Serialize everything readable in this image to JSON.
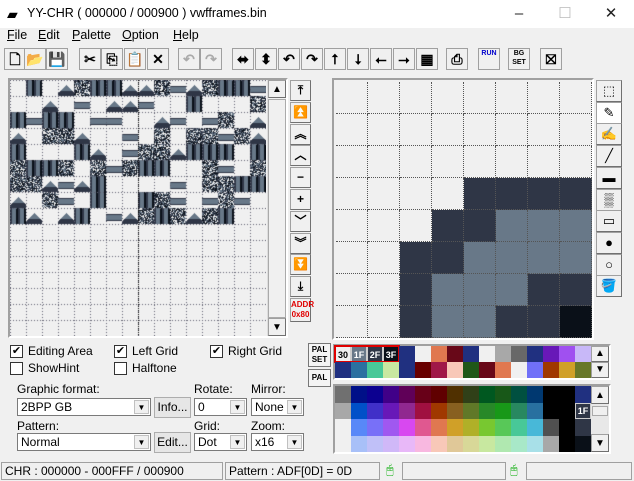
{
  "window": {
    "title": "YY-CHR ( 000000 / 000900 ) vwfframes.bin",
    "minimize": "–",
    "maximize": "☐",
    "close": "✕"
  },
  "menu": [
    {
      "label": "File",
      "key": "F",
      "rest": "ile"
    },
    {
      "label": "Edit",
      "key": "E",
      "rest": "dit"
    },
    {
      "label": "Palette",
      "key": "P",
      "rest": "alette"
    },
    {
      "label": "Option",
      "key": "O",
      "rest": "ption"
    },
    {
      "label": "Help",
      "key": "H",
      "rest": "elp"
    }
  ],
  "toolbar": [
    {
      "name": "new-icon",
      "g": "🗋",
      "dis": false
    },
    {
      "name": "open-icon",
      "g": "📂",
      "dis": false
    },
    {
      "name": "save-icon",
      "g": "💾",
      "dis": false
    },
    {
      "name": "cut-icon",
      "g": "✂",
      "dis": false
    },
    {
      "name": "copy-icon",
      "g": "⎘",
      "dis": false
    },
    {
      "name": "paste-icon",
      "g": "📋",
      "dis": false
    },
    {
      "name": "delete-icon",
      "g": "✕",
      "dis": false
    },
    {
      "name": "undo-icon",
      "g": "↶",
      "dis": true
    },
    {
      "name": "redo-icon",
      "g": "↷",
      "dis": true
    },
    {
      "name": "flip-horizontal-icon",
      "g": "⬌",
      "dis": false
    },
    {
      "name": "flip-vertical-icon",
      "g": "⬍",
      "dis": false
    },
    {
      "name": "rotate-left-icon",
      "g": "↶",
      "dis": false
    },
    {
      "name": "rotate-right-icon",
      "g": "↷",
      "dis": false
    },
    {
      "name": "shift-up-icon",
      "g": "⭡",
      "dis": false
    },
    {
      "name": "shift-down-icon",
      "g": "⭣",
      "dis": false
    },
    {
      "name": "shift-left-icon",
      "g": "⭠",
      "dis": false
    },
    {
      "name": "shift-right-icon",
      "g": "⭢",
      "dis": false
    },
    {
      "name": "replace-color-icon",
      "g": "▦",
      "dis": false
    },
    {
      "name": "capture-icon",
      "g": "⎙",
      "dis": false
    },
    {
      "name": "run-icon",
      "g": "RUN",
      "dis": false
    },
    {
      "name": "bg-set-icon",
      "g": "BG SET",
      "dis": false
    },
    {
      "name": "exit-icon",
      "g": "⛝",
      "dis": false
    }
  ],
  "scroll_buttons": [
    {
      "name": "scroll-top",
      "g": "⤒"
    },
    {
      "name": "scroll-page-up-fast",
      "g": "⏫"
    },
    {
      "name": "scroll-page-up",
      "g": "︽"
    },
    {
      "name": "scroll-up",
      "g": "︿"
    },
    {
      "name": "scroll-minus",
      "g": "−"
    },
    {
      "name": "scroll-plus",
      "g": "+"
    },
    {
      "name": "scroll-down",
      "g": "﹀"
    },
    {
      "name": "scroll-page-down",
      "g": "︾"
    },
    {
      "name": "scroll-page-down-fast",
      "g": "⏬"
    },
    {
      "name": "scroll-bottom",
      "g": "⤓"
    }
  ],
  "addr_button": {
    "line1": "ADDR",
    "line2": "0x80"
  },
  "tools": [
    {
      "name": "select-tool",
      "g": "⬚"
    },
    {
      "name": "pen-tool",
      "g": "✎"
    },
    {
      "name": "brush-tool",
      "g": "✍"
    },
    {
      "name": "line-tool",
      "g": "╱"
    },
    {
      "name": "filled-rect-tool",
      "g": "▬"
    },
    {
      "name": "pattern-fill-tool",
      "g": "▒"
    },
    {
      "name": "rect-tool",
      "g": "▭"
    },
    {
      "name": "filled-circle-tool",
      "g": "●"
    },
    {
      "name": "circle-tool",
      "g": "○"
    },
    {
      "name": "fill-tool",
      "g": "🪣"
    }
  ],
  "edit_pixels": [
    "00000000",
    "00000000",
    "00000000",
    "00002222",
    "00022111",
    "00221111",
    "00211122",
    "00211223"
  ],
  "tile_colors": [
    "#f0f0f0",
    "#687888",
    "#2f3646",
    "#0a1018"
  ],
  "checkboxes": {
    "editing_area": {
      "label": "Editing Area",
      "checked": true
    },
    "left_grid": {
      "label": "Left Grid",
      "checked": true
    },
    "right_grid": {
      "label": "Right Grid",
      "checked": true
    },
    "show_hint": {
      "label": "ShowHint",
      "checked": false
    },
    "halftone": {
      "label": "Halftone",
      "checked": false
    }
  },
  "form": {
    "graphic_format_label": "Graphic format:",
    "graphic_format": "2BPP GB",
    "info_button": "Info...",
    "rotate_label": "Rotate:",
    "rotate": "0",
    "mirror_label": "Mirror:",
    "mirror": "None",
    "pattern_label": "Pattern:",
    "pattern": "Normal",
    "edit_button": "Edit...",
    "grid_label": "Grid:",
    "grid": "Dot",
    "zoom_label": "Zoom:",
    "zoom": "x16"
  },
  "pal_set_button": {
    "line1": "PAL",
    "line2": "SET"
  },
  "pal_button": "PAL",
  "palette_selected": [
    {
      "label": "30",
      "color": "#f0f0f0"
    },
    {
      "label": "1F",
      "color": "#687888"
    },
    {
      "label": "2F",
      "color": "#2f3646"
    },
    {
      "label": "3F",
      "color": "#0a1018"
    }
  ],
  "palette_row1": [
    "#203080",
    "#f0f0f0",
    "#e07850",
    "#680818",
    "#203080",
    "#f0f0f0",
    "#a8a8a8",
    "#686868",
    "#203080",
    "#6818b8",
    "#a050f0",
    "#c8b8f8"
  ],
  "palette_row2": [
    "#203080",
    "#2c70a0",
    "#48c898",
    "#c8e8a0",
    "#203080",
    "#680000",
    "#a01848",
    "#f8c8b8",
    "#205818",
    "#680818",
    "#e07850",
    "#f0f0f0",
    "#7070f8",
    "#a03800",
    "#d0a028",
    "#687828"
  ],
  "master_palette": [
    [
      "#707070",
      "#001088",
      "#0c0090",
      "#400088",
      "#600058",
      "#680018",
      "#600000",
      "#503000",
      "#304018",
      "#005820",
      "#185818",
      "#005040",
      "#003870",
      "#000000",
      "#000000",
      "#203080"
    ],
    [
      "#a8a8a8",
      "#0050c8",
      "#4030c8",
      "#6818b8",
      "#902890",
      "#a01040",
      "#a03800",
      "#886020",
      "#607828",
      "#288828",
      "#189818",
      "#288860",
      "#2870a0",
      "#000000",
      "#000000",
      "#2f3646"
    ],
    [
      "#f0f0f0",
      "#5888f8",
      "#7870f8",
      "#a058f0",
      "#d848f0",
      "#e05890",
      "#e07850",
      "#d0a028",
      "#b0b028",
      "#78c830",
      "#58c858",
      "#48c898",
      "#48b8d8",
      "#505050",
      "#000000",
      "#2f3646"
    ],
    [
      "#f0f0f0",
      "#a8c0f8",
      "#c0c0f8",
      "#d0b8f8",
      "#e8b8f8",
      "#f8b8e0",
      "#f8c8b8",
      "#e0c898",
      "#d8d898",
      "#c8e8a0",
      "#b0e8b0",
      "#a8e8c8",
      "#a8e0e8",
      "#a8a8a8",
      "#000000",
      "#0a1018"
    ]
  ],
  "master_palette_marker": "1F",
  "status": {
    "chr": "CHR : 000000 - 000FFF / 000900",
    "pattern": "Pattern : ADF[0D] = 0D",
    "left_mouse": "",
    "right_mouse": ""
  }
}
